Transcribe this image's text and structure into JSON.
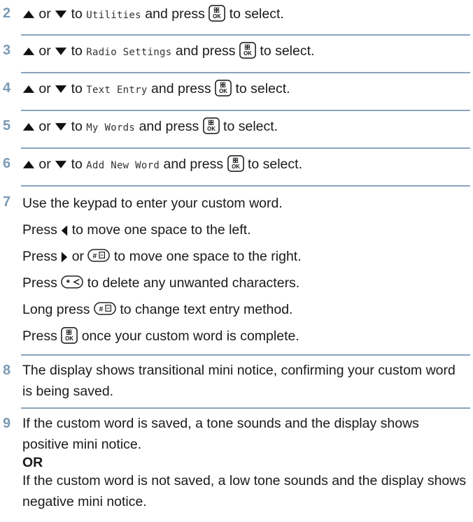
{
  "steps": [
    {
      "num": "2",
      "or_text": "or",
      "to_text": "to",
      "menu": "Utilities",
      "press": "and press",
      "tail": "to select."
    },
    {
      "num": "3",
      "or_text": "or",
      "to_text": "to",
      "menu": "Radio Settings",
      "press": "and press",
      "tail": "to select."
    },
    {
      "num": "4",
      "or_text": "or",
      "to_text": "to",
      "menu": "Text Entry",
      "press": "and press",
      "tail": "to select."
    },
    {
      "num": "5",
      "or_text": "or",
      "to_text": "to",
      "menu": "My Words",
      "press": "and press",
      "tail": "to select."
    },
    {
      "num": "6",
      "or_text": "or",
      "to_text": "to",
      "menu": "Add New Word",
      "press": "and press",
      "tail": "to select."
    }
  ],
  "step7": {
    "num": "7",
    "l1": "Use the keypad to enter your custom word.",
    "l2a": "Press",
    "l2b": "to move one space to the left.",
    "l3a": "Press",
    "l3or": "or",
    "l3b": "to move one space to the right.",
    "l4a": "Press",
    "l4b": "to delete any unwanted characters.",
    "l5a": "Long press",
    "l5b": "to change text entry method.",
    "l6a": "Press",
    "l6b": "once your custom word is complete."
  },
  "step8": {
    "num": "8",
    "text": "The display shows transitional mini notice, confirming your custom word is being saved."
  },
  "step9": {
    "num": "9",
    "t1": "If the custom word is saved, a tone sounds and the display shows positive mini notice.",
    "or": "OR",
    "t2": "If the custom word is not saved, a low tone sounds and the display shows negative mini notice."
  },
  "keys": {
    "ok_top": "☷",
    "ok_bottom": "OK",
    "hash": "# ⊡",
    "star": "✱ ◁"
  },
  "icons": {
    "up": "up-arrow-icon",
    "down": "down-arrow-icon",
    "left": "left-arrow-icon",
    "right": "right-arrow-icon"
  },
  "colors": {
    "number": "#7a9ab5",
    "separator": "#8aa4bd"
  }
}
